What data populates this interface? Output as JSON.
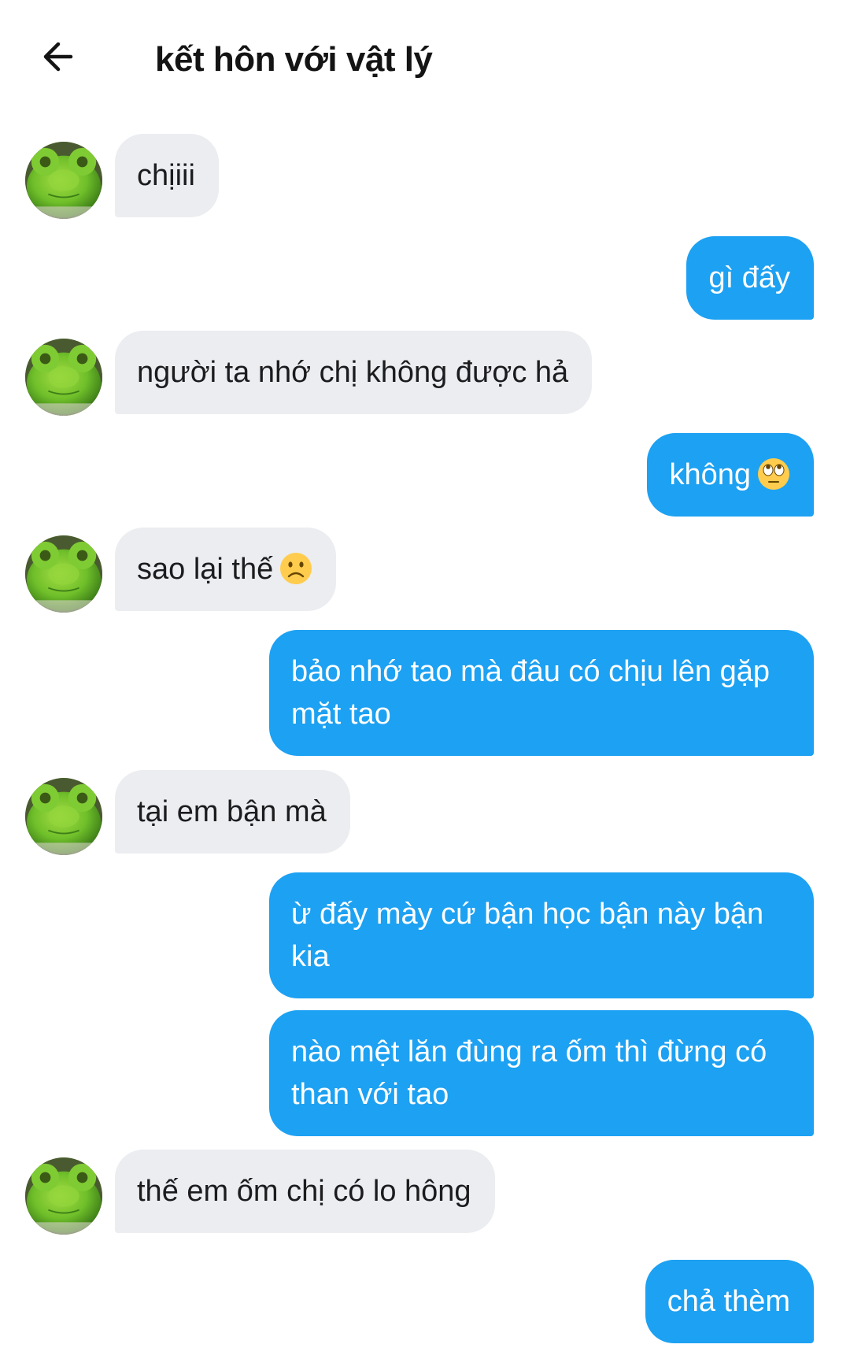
{
  "header": {
    "title": "kết hôn với vật lý",
    "back_icon": "arrow-left-icon"
  },
  "colors": {
    "incoming_bubble": "#ebedf0",
    "outgoing_bubble": "#1da1f2",
    "avatar_green": "#6fbf2a"
  },
  "messages": [
    {
      "direction": "incoming",
      "text": "chịiii"
    },
    {
      "direction": "outgoing",
      "text": "gì đấy"
    },
    {
      "direction": "incoming",
      "text": "người ta nhớ chị không được hả"
    },
    {
      "direction": "outgoing",
      "text": "không",
      "emoji": "rolling-eyes-emoji"
    },
    {
      "direction": "incoming",
      "text": "sao lại thế",
      "emoji": "frowning-face-emoji"
    },
    {
      "direction": "outgoing",
      "lines": [
        "bảo nhớ tao mà đâu có chịu lên gặp",
        "mặt tao"
      ]
    },
    {
      "direction": "incoming",
      "text": "tại em bận mà"
    },
    {
      "direction": "outgoing",
      "lines": [
        "ừ đấy mày cứ bận học bận này bận",
        "kia"
      ]
    },
    {
      "direction": "outgoing",
      "lines": [
        "nào mệt lăn đùng ra ốm thì đừng có",
        "than với tao"
      ]
    },
    {
      "direction": "incoming",
      "text": "thế em ốm chị có lo hông"
    },
    {
      "direction": "outgoing",
      "text": "chả thèm"
    }
  ]
}
